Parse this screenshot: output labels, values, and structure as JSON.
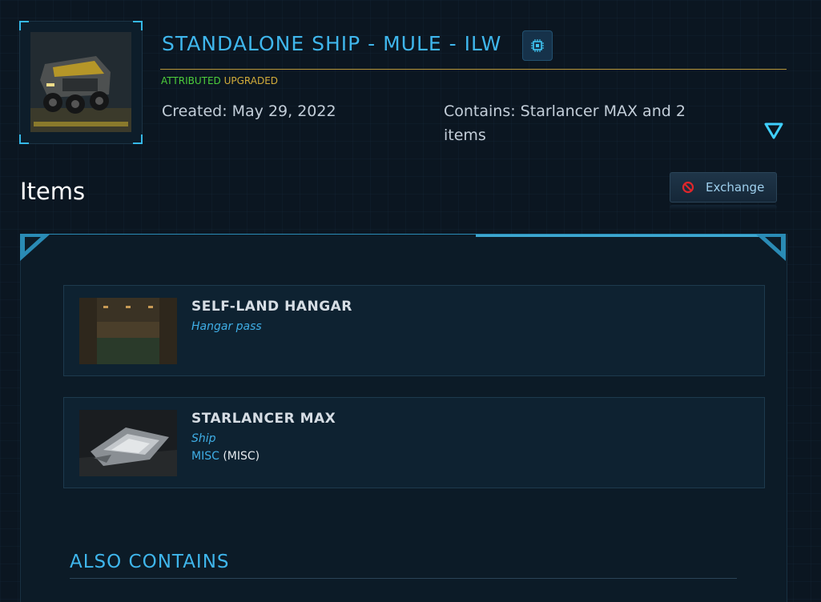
{
  "pledge": {
    "title": "STANDALONE SHIP - MULE - ILW",
    "badges": {
      "attributed": "ATTRIBUTED",
      "upgraded": "UPGRADED"
    },
    "created": "Created: May 29, 2022",
    "contains": "Contains: Starlancer MAX and 2 items"
  },
  "items_section": {
    "heading": "Items",
    "exchange_label": "Exchange"
  },
  "items": [
    {
      "name": "SELF-LAND HANGAR",
      "type": "Hangar pass"
    },
    {
      "name": "STARLANCER MAX",
      "type": "Ship",
      "manufacturer": "MISC",
      "manufacturer_code": "(MISC)"
    }
  ],
  "also_contains": {
    "heading": "ALSO CONTAINS"
  },
  "colors": {
    "accent": "#3fb6ec",
    "attributed": "#4dce3b",
    "upgraded": "#d3ad3a",
    "exchange_icon": "#e0262b"
  },
  "icons": {
    "chip": "chip-icon",
    "toggle": "expand-triangle-icon",
    "exchange": "no-entry-icon"
  }
}
